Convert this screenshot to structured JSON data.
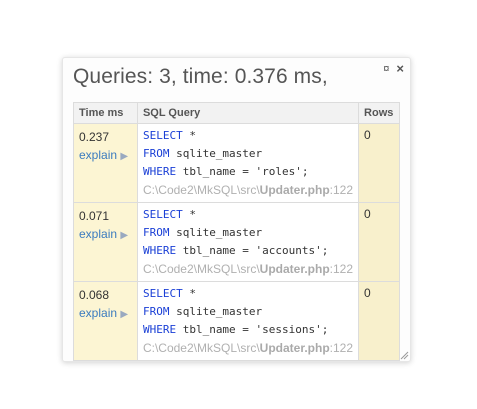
{
  "panel": {
    "title": "Queries: 3, time: 0.376 ms,",
    "maximize_icon": "¤",
    "close_icon": "×"
  },
  "table": {
    "headers": [
      "Time ms",
      "SQL Query",
      "Rows"
    ],
    "explain_label": "explain",
    "explain_arrow": "▶",
    "rows": [
      {
        "time": "0.237",
        "select_kw": "SELECT",
        "select_rest": " *",
        "from_kw": "FROM",
        "from_rest": " sqlite_master",
        "where_kw": "WHERE",
        "where_rest": " tbl_name = 'roles';",
        "src_path": "C:\\Code2\\MkSQL\\src\\",
        "src_file": "Updater.php",
        "src_line": ":122",
        "rows": "0"
      },
      {
        "time": "0.071",
        "select_kw": "SELECT",
        "select_rest": " *",
        "from_kw": "FROM",
        "from_rest": " sqlite_master",
        "where_kw": "WHERE",
        "where_rest": " tbl_name = 'accounts';",
        "src_path": "C:\\Code2\\MkSQL\\src\\",
        "src_file": "Updater.php",
        "src_line": ":122",
        "rows": "0"
      },
      {
        "time": "0.068",
        "select_kw": "SELECT",
        "select_rest": " *",
        "from_kw": "FROM",
        "from_rest": " sqlite_master",
        "where_kw": "WHERE",
        "where_rest": " tbl_name = 'sessions';",
        "src_path": "C:\\Code2\\MkSQL\\src\\",
        "src_file": "Updater.php",
        "src_line": ":122",
        "rows": "0"
      }
    ]
  },
  "colors": {
    "keyword": "#1a3fd6",
    "link": "#3b7bbf",
    "time_cell_bg": "#fcf5d3",
    "rows_cell_bg": "#f8f0cc",
    "source_text": "#b0b0b0"
  }
}
